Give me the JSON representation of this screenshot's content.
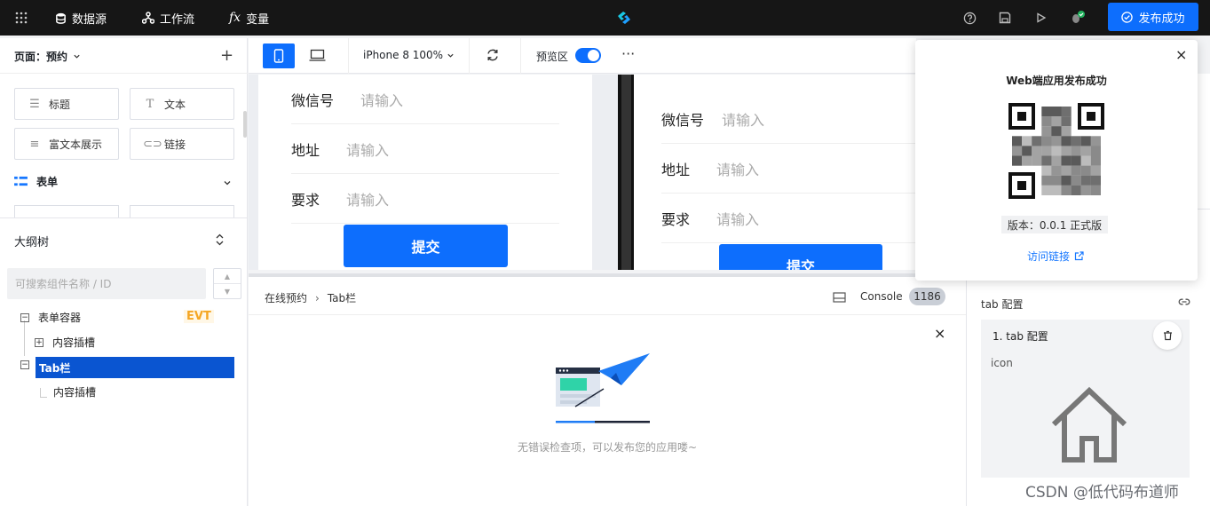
{
  "topbar": {
    "datasource": "数据源",
    "workflow": "工作流",
    "variables": "变量",
    "fx": "fx",
    "publish_label": "发布成功"
  },
  "left": {
    "page_title": "页面：预约",
    "components": [
      "标题",
      "文本",
      "富文本展示",
      "链接"
    ],
    "group_form": "表单",
    "outline_title": "大纲树",
    "search_placeholder": "可搜索组件名称 / ID",
    "tree": {
      "form_container": "表单容器",
      "evt": "EVT",
      "slot1": "内容插槽",
      "tabbar": "Tab栏",
      "slot2": "内容插槽"
    }
  },
  "toolbar": {
    "device": "iPhone 8 100%",
    "preview": "预览区"
  },
  "canvas": {
    "fields": [
      "微信号",
      "地址",
      "要求"
    ],
    "placeholder": "请输入",
    "submit": "提交"
  },
  "bottom": {
    "crumb1": "在线预约",
    "crumb2": "Tab栏",
    "console": "Console",
    "count": "1186",
    "empty_text": "无错误检查项，可以发布您的应用喽~"
  },
  "right": {
    "section": "tab 配置",
    "item": "1. tab 配置",
    "icon_label": "icon"
  },
  "popup": {
    "title": "Web端应用发布成功",
    "version": "版本：0.0.1 正式版",
    "link": "访问链接"
  },
  "watermark": "CSDN @低代码布道师"
}
